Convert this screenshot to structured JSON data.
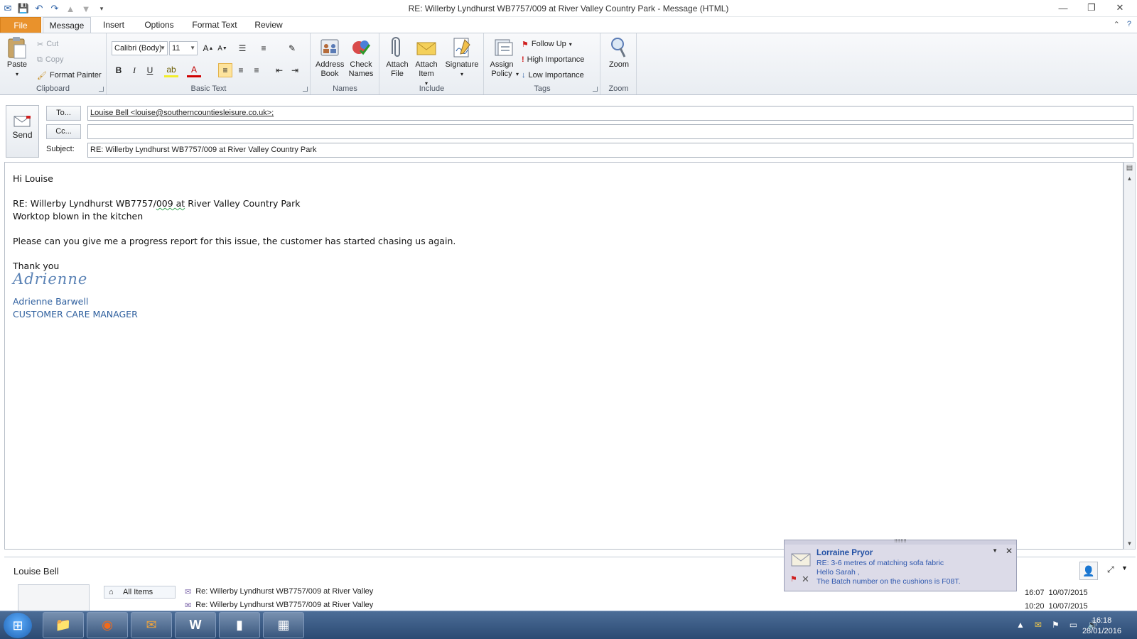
{
  "window": {
    "title": "RE: Willerby Lyndhurst WB7757/009  at River Valley Country Park  -  Message (HTML)"
  },
  "tabs": [
    "File",
    "Message",
    "Insert",
    "Options",
    "Format Text",
    "Review"
  ],
  "ribbon": {
    "clipboard": {
      "paste": "Paste",
      "cut": "Cut",
      "copy": "Copy",
      "format_painter": "Format Painter",
      "label": "Clipboard"
    },
    "basic_text": {
      "font": "Calibri (Body)",
      "size": "11",
      "label": "Basic Text"
    },
    "names": {
      "address_book": "Address Book",
      "check_names": "Check Names",
      "label": "Names"
    },
    "include": {
      "attach_file": "Attach File",
      "attach_item": "Attach Item",
      "signature": "Signature",
      "label": "Include"
    },
    "tags": {
      "assign_policy": "Assign Policy",
      "follow_up": "Follow Up",
      "high_importance": "High Importance",
      "low_importance": "Low Importance",
      "label": "Tags"
    },
    "zoom": {
      "zoom": "Zoom",
      "label": "Zoom"
    }
  },
  "header": {
    "send": "Send",
    "to_button": "To...",
    "cc_button": "Cc...",
    "subject_label": "Subject:",
    "to_value": "Louise Bell <louise@southerncountiesleisure.co.uk>;",
    "cc_value": "",
    "subject_value": "RE: Willerby Lyndhurst WB7757/009  at River Valley Country Park"
  },
  "body": {
    "greeting": "Hi Louise",
    "ref_line_a": "RE: Willerby Lyndhurst WB7757/",
    "ref_line_b": "009  at",
    "ref_line_c": " River Valley Country Park",
    "issue": "Worktop blown in the kitchen",
    "request": "Please can you give me a progress report for this issue, the customer has started chasing us again.",
    "thanks": "Thank you",
    "signature_script": "Adrienne",
    "signature_name": "Adrienne Barwell",
    "signature_role": "CUSTOMER CARE MANAGER"
  },
  "people_pane": {
    "name": "Louise Bell",
    "all_items": "All Items",
    "rows": [
      {
        "subject": "Re: Willerby Lyndhurst WB7757/009 at River Valley",
        "time": "16:07",
        "date": "10/07/2015"
      },
      {
        "subject": "Re: Willerby Lyndhurst WB7757/009 at River Valley",
        "time": "10:20",
        "date": "10/07/2015"
      }
    ]
  },
  "alert": {
    "from": "Lorraine Pryor",
    "subject": "RE: 3-6 metres of matching sofa fabric",
    "line1": "Hello Sarah ,",
    "line2": "The Batch number on the cushions is F08T."
  },
  "taskbar": {
    "time": "16:18",
    "date": "28/01/2016"
  }
}
